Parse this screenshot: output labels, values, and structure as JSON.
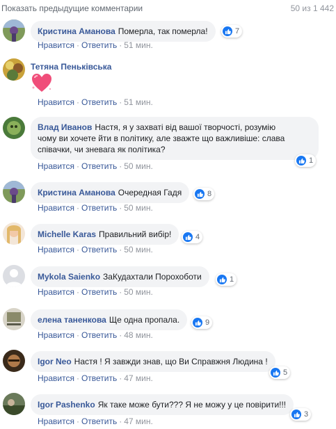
{
  "header": {
    "prev_comments": "Показать предыдущие комментарии",
    "count": "50 из 1 442"
  },
  "actions": {
    "like": "Нравится",
    "reply": "Ответить"
  },
  "comments": [
    {
      "author": "Кристина Аманова",
      "text": "Померла, так померла!",
      "reactions": "7",
      "time": "51 мин."
    },
    {
      "author": "Тетяна Пеньківська",
      "text": "",
      "sticker": "heart-sticker",
      "reactions": "",
      "time": "51 мин."
    },
    {
      "author": "Влад Иванов",
      "text": "Настя, я у захваті від вашої творчості, розумію",
      "text2": "чому ви хочете йти в політику, але зважте що важливіше: слава",
      "text3": "співачки, чи зневага як політика?",
      "reactions": "1",
      "time": "50 мин."
    },
    {
      "author": "Кристина Аманова",
      "text": "Очередная Гадя",
      "reactions": "8",
      "time": "50 мин."
    },
    {
      "author": "Michelle Karas",
      "text": "Правильний вибір!",
      "reactions": "4",
      "time": "50 мин."
    },
    {
      "author": "Mykola Saienko",
      "text": "ЗаКудахтали Порохоботи",
      "reactions": "1",
      "time": "50 мин."
    },
    {
      "author": "елена таненкова",
      "text": "Ще одна пропала.",
      "reactions": "9",
      "time": "48 мин."
    },
    {
      "author": "Igor Neo",
      "text": "Настя ! Я завжди знав, що Ви Справжня Людина !",
      "reactions": "5",
      "time": "47 мин."
    },
    {
      "author": "Igor Pashenko",
      "text": "Як таке може бути??? Я не можу у це повірити!!!",
      "reactions": "3",
      "time": "47 мин."
    }
  ],
  "colors": {
    "link": "#385898",
    "bubble": "#f2f3f5",
    "like": "#1877f2",
    "muted": "#90949c"
  }
}
